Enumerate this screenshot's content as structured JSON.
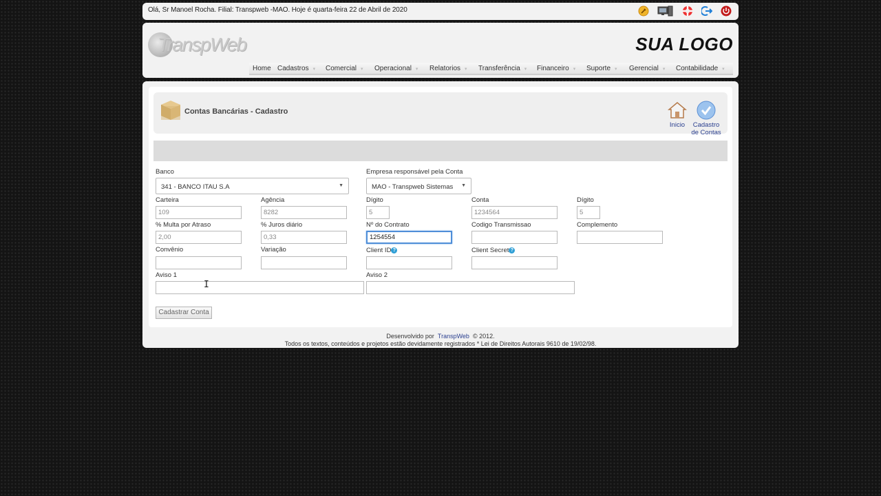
{
  "topbar": {
    "greeting": "Olá, Sr Manoel Rocha. Filial: Transpweb -MAO. Hoje é quarta-feira 22 de Abril de 2020",
    "icons": [
      "tools-icon",
      "monitor-icon",
      "lifebuoy-icon",
      "logout-icon",
      "power-icon"
    ]
  },
  "header": {
    "logo_left": "TranspWeb",
    "logo_right": "SUA LOGO",
    "menu": [
      {
        "label": "Home",
        "has_arrow": false
      },
      {
        "label": "Cadastros",
        "has_arrow": true
      },
      {
        "label": "Comercial",
        "has_arrow": true
      },
      {
        "label": "Operacional",
        "has_arrow": true
      },
      {
        "label": "Relatorios",
        "has_arrow": true
      },
      {
        "label": "Transferência",
        "has_arrow": true
      },
      {
        "label": "Financeiro",
        "has_arrow": true
      },
      {
        "label": "Suporte",
        "has_arrow": true
      },
      {
        "label": "Gerencial",
        "has_arrow": true
      },
      {
        "label": "Contabilidade",
        "has_arrow": true
      }
    ]
  },
  "page": {
    "title": "Contas Bancárias - Cadastro",
    "actions": {
      "inicio": "Inicio",
      "cadastro_1": "Cadastro",
      "cadastro_2": "de Contas"
    }
  },
  "form": {
    "banco": {
      "label": "Banco",
      "value": "341 - BANCO ITAU S.A"
    },
    "empresa": {
      "label": "Empresa responsável pela Conta",
      "value": "MAO - Transpweb Sistemas"
    },
    "carteira": {
      "label": "Carteira",
      "value": "109"
    },
    "agencia": {
      "label": "Agência",
      "value": "8282"
    },
    "digito1": {
      "label": "Dígito",
      "value": "5"
    },
    "conta": {
      "label": "Conta",
      "value": "1234564"
    },
    "digito2": {
      "label": "Dígito",
      "value": "5"
    },
    "multa": {
      "label": "% Multa por Atraso",
      "value": "2,00"
    },
    "juros": {
      "label": "% Juros diário",
      "value": "0,33"
    },
    "contrato": {
      "label": "Nº do Contrato",
      "value": "1254554"
    },
    "codigo": {
      "label": "Codigo Transmissao",
      "value": ""
    },
    "complemento": {
      "label": "Complemento",
      "value": ""
    },
    "convenio": {
      "label": "Convênio",
      "value": ""
    },
    "variacao": {
      "label": "Variação",
      "value": ""
    },
    "client_id": {
      "label": "Client ID",
      "value": ""
    },
    "client_secret": {
      "label": "Client Secret",
      "value": ""
    },
    "aviso1": {
      "label": "Aviso 1",
      "value": ""
    },
    "aviso2": {
      "label": "Aviso 2",
      "value": ""
    },
    "submit": "Cadastrar Conta"
  },
  "footer": {
    "prefix": "Desenvolvido por",
    "link": "TranspWeb",
    "suffix": "© 2012.",
    "line2": "Todos os textos, conteúdos e projetos estão devidamente registrados * Lei de Direitos Autorais 9610 de 19/02/98."
  }
}
